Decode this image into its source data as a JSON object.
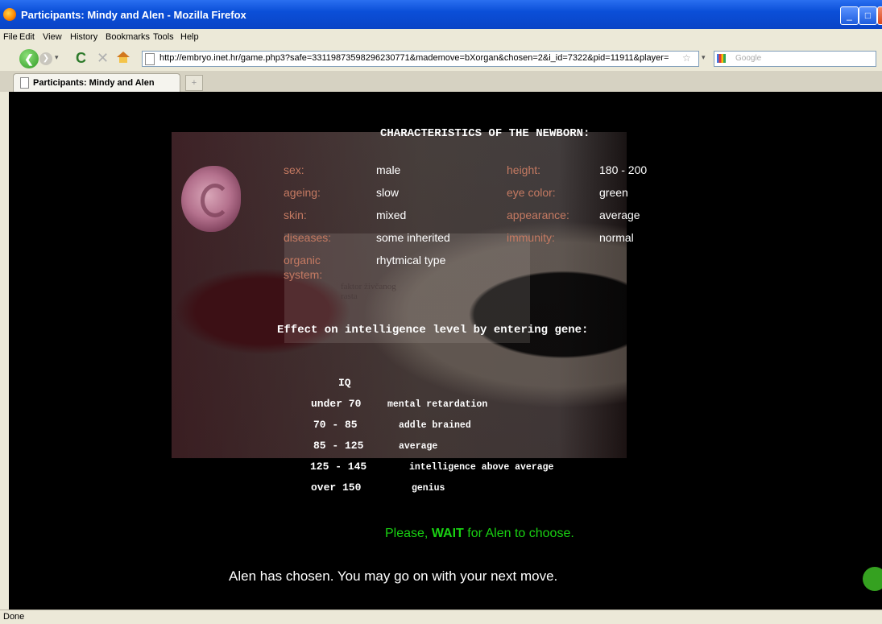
{
  "window": {
    "title": "Participants: Mindy and Alen - Mozilla Firefox"
  },
  "menu": [
    "File",
    "Edit",
    "View",
    "History",
    "Bookmarks",
    "Tools",
    "Help"
  ],
  "nav": {
    "url": "http://embryo.inet.hr/game.php3?safe=33119873598296230771&mademove=bXorgan&chosen=2&i_id=7322&pid=11911&player=",
    "search_placeholder": "Google"
  },
  "tab": {
    "label": "Participants: Mindy and Alen",
    "new_tab_label": "+"
  },
  "page": {
    "heading": "CHARACTERISTICS OF THE NEWBORN:",
    "traits_left": [
      {
        "label": "sex:",
        "value": "male"
      },
      {
        "label": "ageing:",
        "value": "slow"
      },
      {
        "label": "skin:",
        "value": "mixed"
      },
      {
        "label": "diseases:",
        "value": "some inherited"
      },
      {
        "label": "organic system:",
        "value": "rhytmical type"
      }
    ],
    "traits_right": [
      {
        "label": "height:",
        "value": "180 - 200"
      },
      {
        "label": "eye color:",
        "value": "green"
      },
      {
        "label": "appearance:",
        "value": "average"
      },
      {
        "label": "immunity:",
        "value": "normal"
      }
    ],
    "background_text": [
      "faktor živčanog",
      "rasta"
    ],
    "effect_heading": "Effect on intelligence level by entering gene:",
    "iq_label": "IQ",
    "iq_rows": [
      {
        "range": "under 70",
        "desc": "mental retardation"
      },
      {
        "range": "70 - 85",
        "desc": "addle brained"
      },
      {
        "range": "85 - 125",
        "desc": "average"
      },
      {
        "range": "125 - 145",
        "desc": "intelligence above average"
      },
      {
        "range": "over 150",
        "desc": "genius"
      }
    ],
    "wait_prefix": "Please, ",
    "wait_bold": "WAIT",
    "wait_suffix": " for Alen to choose.",
    "chosen_message": "Alen has chosen. You may go on with your next move."
  },
  "status": "Done"
}
